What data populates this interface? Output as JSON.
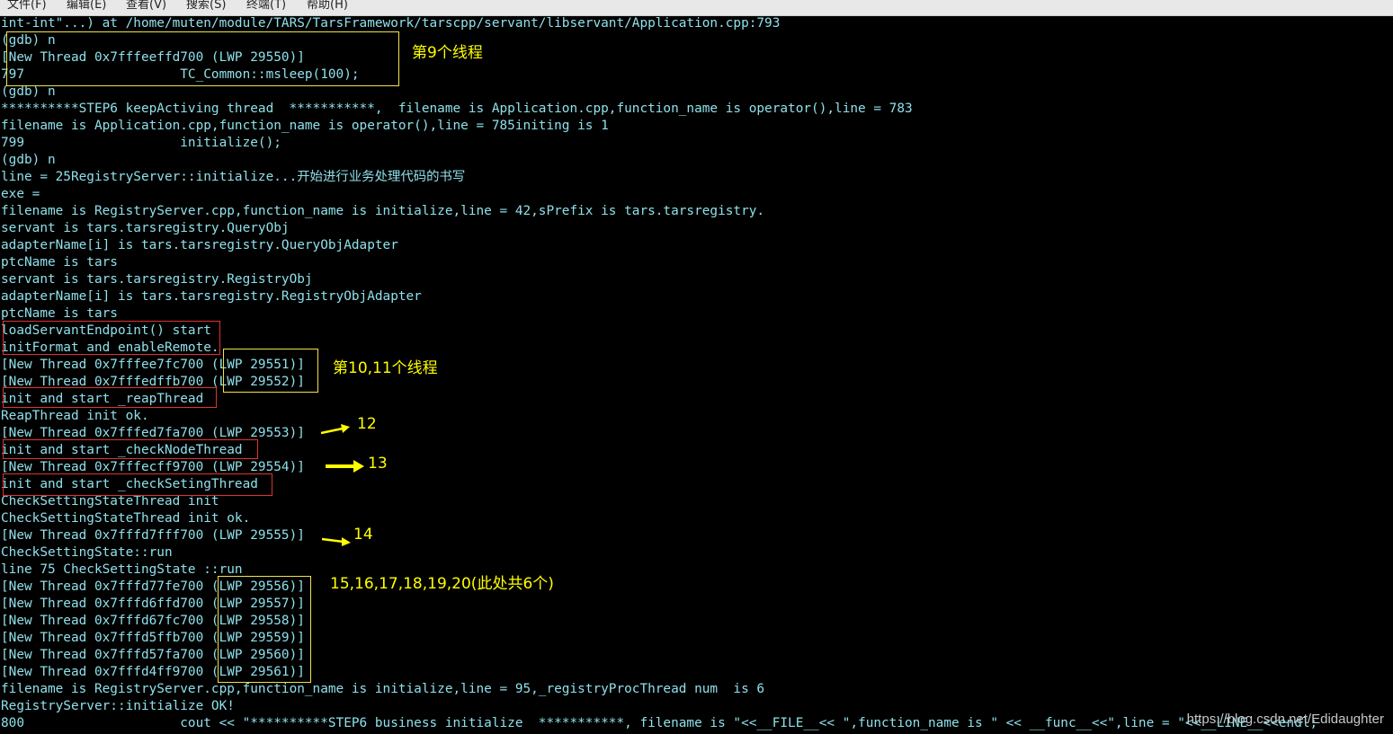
{
  "menubar": {
    "items": [
      "文件(F)",
      "编辑(E)",
      "查看(V)",
      "搜索(S)",
      "终端(T)",
      "帮助(H)"
    ]
  },
  "terminal": {
    "lines": [
      "int-int\"...) at /home/muten/module/TARS/TarsFramework/tarscpp/servant/libservant/Application.cpp:793",
      "(gdb) n",
      "[New Thread 0x7fffeeffd700 (LWP 29550)]",
      "797                    TC_Common::msleep(100);",
      "(gdb) n",
      "**********STEP6 keepActiving thread  ***********,  filename is Application.cpp,function_name is operator(),line = 783",
      "filename is Application.cpp,function_name is operator(),line = 785initing is 1",
      "799                    initialize();",
      "(gdb) n",
      "line = 25RegistryServer::initialize...开始进行业务处理代码的书写",
      "exe =",
      "filename is RegistryServer.cpp,function_name is initialize,line = 42,sPrefix is tars.tarsregistry.",
      "servant is tars.tarsregistry.QueryObj",
      "adapterName[i] is tars.tarsregistry.QueryObjAdapter",
      "ptcName is tars",
      "servant is tars.tarsregistry.RegistryObj",
      "adapterName[i] is tars.tarsregistry.RegistryObjAdapter",
      "ptcName is tars",
      "loadServantEndpoint() start",
      "initFormat and enableRemote.",
      "[New Thread 0x7fffee7fc700 (LWP 29551)]",
      "[New Thread 0x7fffedffb700 (LWP 29552)]",
      "init and start _reapThread",
      "ReapThread init ok.",
      "[New Thread 0x7fffed7fa700 (LWP 29553)]",
      "init and start _checkNodeThread",
      "[New Thread 0x7fffecff9700 (LWP 29554)]",
      "init and start _checkSetingThread",
      "CheckSettingStateThread init",
      "CheckSettingStateThread init ok.",
      "[New Thread 0x7fffd7fff700 (LWP 29555)]",
      "CheckSettingState::run",
      "line 75 CheckSettingState ::run",
      "[New Thread 0x7fffd77fe700 (LWP 29556)]",
      "[New Thread 0x7fffd6ffd700 (LWP 29557)]",
      "[New Thread 0x7fffd67fc700 (LWP 29558)]",
      "[New Thread 0x7fffd5ffb700 (LWP 29559)]",
      "[New Thread 0x7fffd57fa700 (LWP 29560)]",
      "[New Thread 0x7fffd4ff9700 (LWP 29561)]",
      "filename is RegistryServer.cpp,function_name is initialize,line = 95,_registryProcThread num  is 6",
      "RegistryServer::initialize OK!",
      "800                    cout << \"**********STEP6 business initialize  ***********, filename is \"<<__FILE__<< \",function_name is \" << __func__<<\",line = \"<<__LINE__<<endl;"
    ]
  },
  "annotations": {
    "thread9": "第9个线程",
    "thread10_11": "第10,11个线程",
    "thread12": "12",
    "thread13": "13",
    "thread14": "14",
    "thread15_20": "15,16,17,18,19,20(此处共6个)"
  },
  "watermark": "https://blog.csdn.net/Edidaughter",
  "colors": {
    "terminal_bg": "#000000",
    "terminal_text": "#8fe0ea",
    "annotation_yellow": "#ffff00",
    "box_yellow": "#f0e24a",
    "box_red": "#e0322e"
  }
}
